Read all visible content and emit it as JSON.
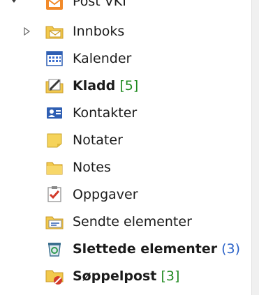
{
  "header": {
    "account_label": "Post VKI"
  },
  "folders": [
    {
      "label": "Innboks",
      "count": "",
      "bracket": "",
      "bold": false
    },
    {
      "label": "Kalender",
      "count": "",
      "bracket": "",
      "bold": false
    },
    {
      "label": "Kladd",
      "count": "5",
      "bracket": "square",
      "bold": true
    },
    {
      "label": "Kontakter",
      "count": "",
      "bracket": "",
      "bold": false
    },
    {
      "label": "Notater",
      "count": "",
      "bracket": "",
      "bold": false
    },
    {
      "label": "Notes",
      "count": "",
      "bracket": "",
      "bold": false
    },
    {
      "label": "Oppgaver",
      "count": "",
      "bracket": "",
      "bold": false
    },
    {
      "label": "Sendte elementer",
      "count": "",
      "bracket": "",
      "bold": false
    },
    {
      "label": "Slettede elementer",
      "count": "3",
      "bracket": "round",
      "bold": true
    },
    {
      "label": "Søppelpost",
      "count": "3",
      "bracket": "square",
      "bold": true
    }
  ],
  "icons": {
    "account": "account-folder-icon",
    "innboks": "inbox-folder-icon",
    "kalender": "calendar-icon",
    "kladd": "drafts-icon",
    "kontakter": "contacts-icon",
    "notater": "notes-icon",
    "notes": "folder-icon",
    "oppgaver": "tasks-icon",
    "sendte": "sent-items-icon",
    "slettede": "deleted-items-icon",
    "soppelpost": "junk-mail-icon"
  },
  "colors": {
    "count_green": "#1f8a1f",
    "count_blue": "#2a62c8",
    "folder_yellow": "#f2c94c"
  }
}
